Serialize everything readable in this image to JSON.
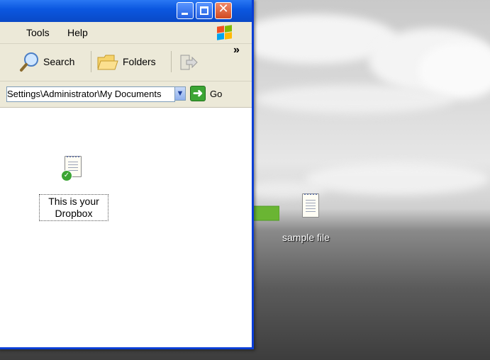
{
  "menu": {
    "tools": "Tools",
    "help": "Help"
  },
  "toolbar": {
    "search_label": "Search",
    "folders_label": "Folders",
    "chevron": "»"
  },
  "address": {
    "path": "Settings\\Administrator\\My Documents",
    "go_label": "Go"
  },
  "explorer_file": {
    "label_line1": "This is your",
    "label_line2": "Dropbox"
  },
  "desktop_file": {
    "label": "sample file"
  },
  "colors": {
    "titlebar": "#0b57e0",
    "arrow": "#6ab533",
    "go_button": "#3ca534"
  }
}
